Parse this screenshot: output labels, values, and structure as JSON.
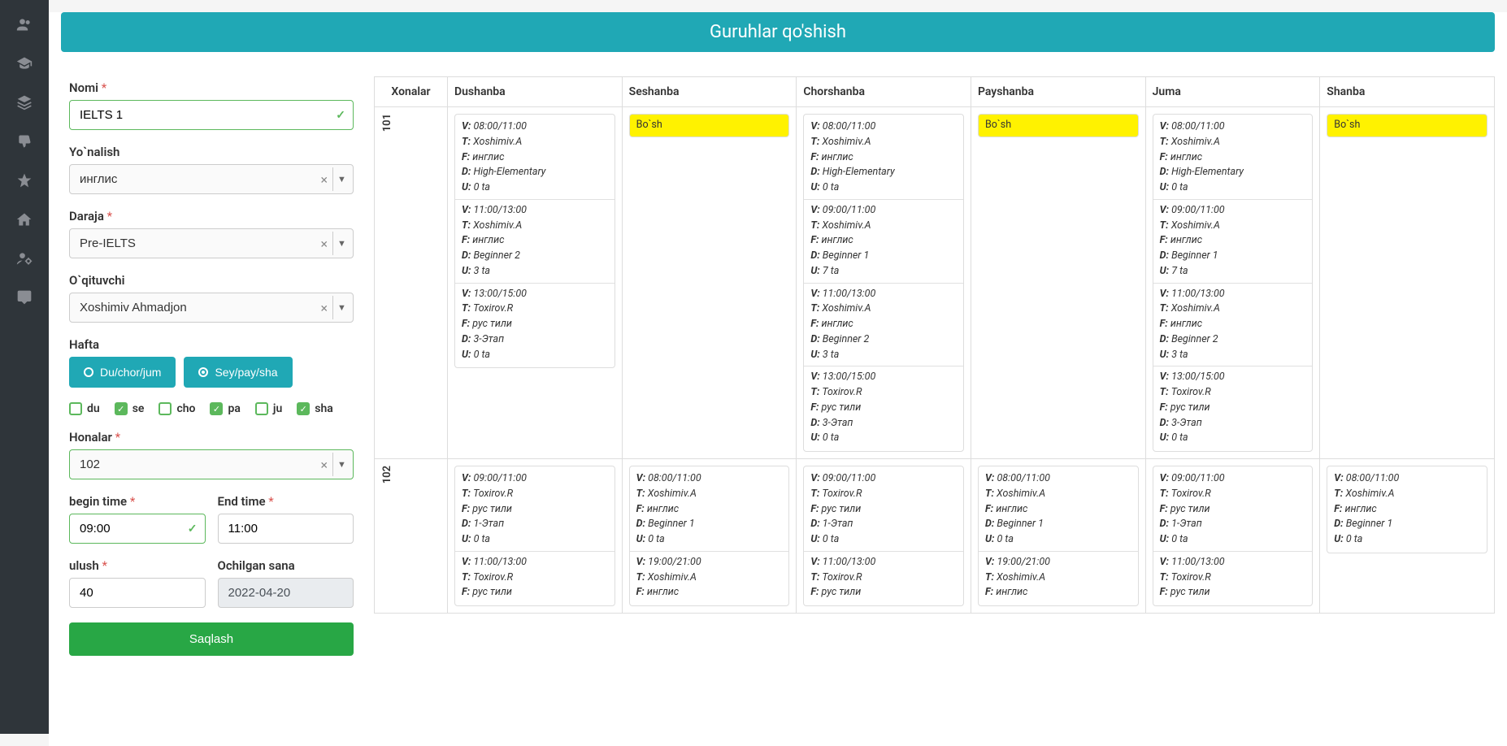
{
  "header": {
    "title": "Guruhlar qo'shish"
  },
  "sidebar": {
    "items": [
      "users-icon",
      "graduation-icon",
      "layers-icon",
      "thumbs-down-icon",
      "star-icon",
      "home-icon",
      "user-cog-icon",
      "comments-icon"
    ]
  },
  "form": {
    "nomi": {
      "label": "Nomi",
      "value": "IELTS 1"
    },
    "yonalish": {
      "label": "Yo`nalish",
      "value": "инглис"
    },
    "daraja": {
      "label": "Daraja",
      "value": "Pre-IELTS"
    },
    "oqituvchi": {
      "label": "O`qituvchi",
      "value": "Xoshimiv Ahmadjon"
    },
    "hafta": {
      "label": "Hafta",
      "opt1": "Du/chor/jum",
      "opt2": "Sey/pay/sha"
    },
    "days": [
      {
        "key": "du",
        "label": "du",
        "checked": false
      },
      {
        "key": "se",
        "label": "se",
        "checked": true
      },
      {
        "key": "cho",
        "label": "cho",
        "checked": false
      },
      {
        "key": "pa",
        "label": "pa",
        "checked": true
      },
      {
        "key": "ju",
        "label": "ju",
        "checked": false
      },
      {
        "key": "sha",
        "label": "sha",
        "checked": true
      }
    ],
    "honalar": {
      "label": "Honalar",
      "value": "102"
    },
    "begin": {
      "label": "begin time",
      "value": "09:00"
    },
    "end": {
      "label": "End time",
      "value": "11:00"
    },
    "ulush": {
      "label": "ulush",
      "value": "40"
    },
    "ochilgan": {
      "label": "Ochilgan sana",
      "value": "2022-04-20"
    },
    "save": "Saqlash"
  },
  "schedule": {
    "headers": [
      "Xonalar",
      "Dushanba",
      "Seshanba",
      "Chorshanba",
      "Payshanba",
      "Juma",
      "Shanba"
    ],
    "empty_label": "Bo`sh",
    "rooms": [
      {
        "name": "101",
        "days": [
          [
            {
              "V": "08:00/11:00",
              "T": "Xoshimiv.A",
              "F": "инглис",
              "D": "High-Elementary",
              "U": "0 ta"
            },
            {
              "V": "11:00/13:00",
              "T": "Xoshimiv.A",
              "F": "инглис",
              "D": "Beginner 2",
              "U": "3 ta"
            },
            {
              "V": "13:00/15:00",
              "T": "Toxirov.R",
              "F": "рус тили",
              "D": "3-Этап",
              "U": "0 ta"
            }
          ],
          "empty",
          [
            {
              "V": "08:00/11:00",
              "T": "Xoshimiv.A",
              "F": "инглис",
              "D": "High-Elementary",
              "U": "0 ta"
            },
            {
              "V": "09:00/11:00",
              "T": "Xoshimiv.A",
              "F": "инглис",
              "D": "Beginner 1",
              "U": "7 ta"
            },
            {
              "V": "11:00/13:00",
              "T": "Xoshimiv.A",
              "F": "инглис",
              "D": "Beginner 2",
              "U": "3 ta"
            },
            {
              "V": "13:00/15:00",
              "T": "Toxirov.R",
              "F": "рус тили",
              "D": "3-Этап",
              "U": "0 ta"
            }
          ],
          "empty",
          [
            {
              "V": "08:00/11:00",
              "T": "Xoshimiv.A",
              "F": "инглис",
              "D": "High-Elementary",
              "U": "0 ta"
            },
            {
              "V": "09:00/11:00",
              "T": "Xoshimiv.A",
              "F": "инглис",
              "D": "Beginner 1",
              "U": "7 ta"
            },
            {
              "V": "11:00/13:00",
              "T": "Xoshimiv.A",
              "F": "инглис",
              "D": "Beginner 2",
              "U": "3 ta"
            },
            {
              "V": "13:00/15:00",
              "T": "Toxirov.R",
              "F": "рус тили",
              "D": "3-Этап",
              "U": "0 ta"
            }
          ],
          "empty"
        ]
      },
      {
        "name": "102",
        "days": [
          [
            {
              "V": "09:00/11:00",
              "T": "Toxirov.R",
              "F": "рус тили",
              "D": "1-Этап",
              "U": "0 ta"
            },
            {
              "V": "11:00/13:00",
              "T": "Toxirov.R",
              "F": "рус тили"
            }
          ],
          [
            {
              "V": "08:00/11:00",
              "T": "Xoshimiv.A",
              "F": "инглис",
              "D": "Beginner 1",
              "U": "0 ta"
            },
            {
              "V": "19:00/21:00",
              "T": "Xoshimiv.A",
              "F": "инглис"
            }
          ],
          [
            {
              "V": "09:00/11:00",
              "T": "Toxirov.R",
              "F": "рус тили",
              "D": "1-Этап",
              "U": "0 ta"
            },
            {
              "V": "11:00/13:00",
              "T": "Toxirov.R",
              "F": "рус тили"
            }
          ],
          [
            {
              "V": "08:00/11:00",
              "T": "Xoshimiv.A",
              "F": "инглис",
              "D": "Beginner 1",
              "U": "0 ta"
            },
            {
              "V": "19:00/21:00",
              "T": "Xoshimiv.A",
              "F": "инглис"
            }
          ],
          [
            {
              "V": "09:00/11:00",
              "T": "Toxirov.R",
              "F": "рус тили",
              "D": "1-Этап",
              "U": "0 ta"
            },
            {
              "V": "11:00/13:00",
              "T": "Toxirov.R",
              "F": "рус тили"
            }
          ],
          [
            {
              "V": "08:00/11:00",
              "T": "Xoshimiv.A",
              "F": "инглис",
              "D": "Beginner 1",
              "U": "0 ta"
            }
          ]
        ]
      }
    ]
  }
}
